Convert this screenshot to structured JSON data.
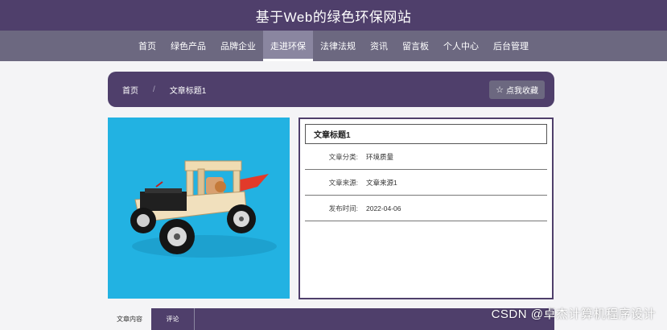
{
  "header": {
    "site_title": "基于Web的绿色环保网站"
  },
  "nav": {
    "items": [
      "首页",
      "绿色产品",
      "品牌企业",
      "走进环保",
      "法律法规",
      "资讯",
      "留言板",
      "个人中心",
      "后台管理"
    ],
    "active_index": 3
  },
  "breadcrumb": {
    "home": "首页",
    "separator": "/",
    "current": "文章标题1"
  },
  "favorite_button": {
    "icon": "☆",
    "label": "点我收藏"
  },
  "article": {
    "title": "文章标题1",
    "category_label": "文章分类:",
    "category_value": "环境质量",
    "source_label": "文章来源:",
    "source_value": "文章来源1",
    "date_label": "发布时间:",
    "date_value": "2022-04-06"
  },
  "tabs": {
    "content": "文章内容",
    "comments": "评论"
  },
  "watermark": "CSDN @卓杰计算机程序设计",
  "colors": {
    "primary": "#4f3f6b",
    "nav": "#6c6880",
    "photo_bg": "#22b2e2"
  }
}
